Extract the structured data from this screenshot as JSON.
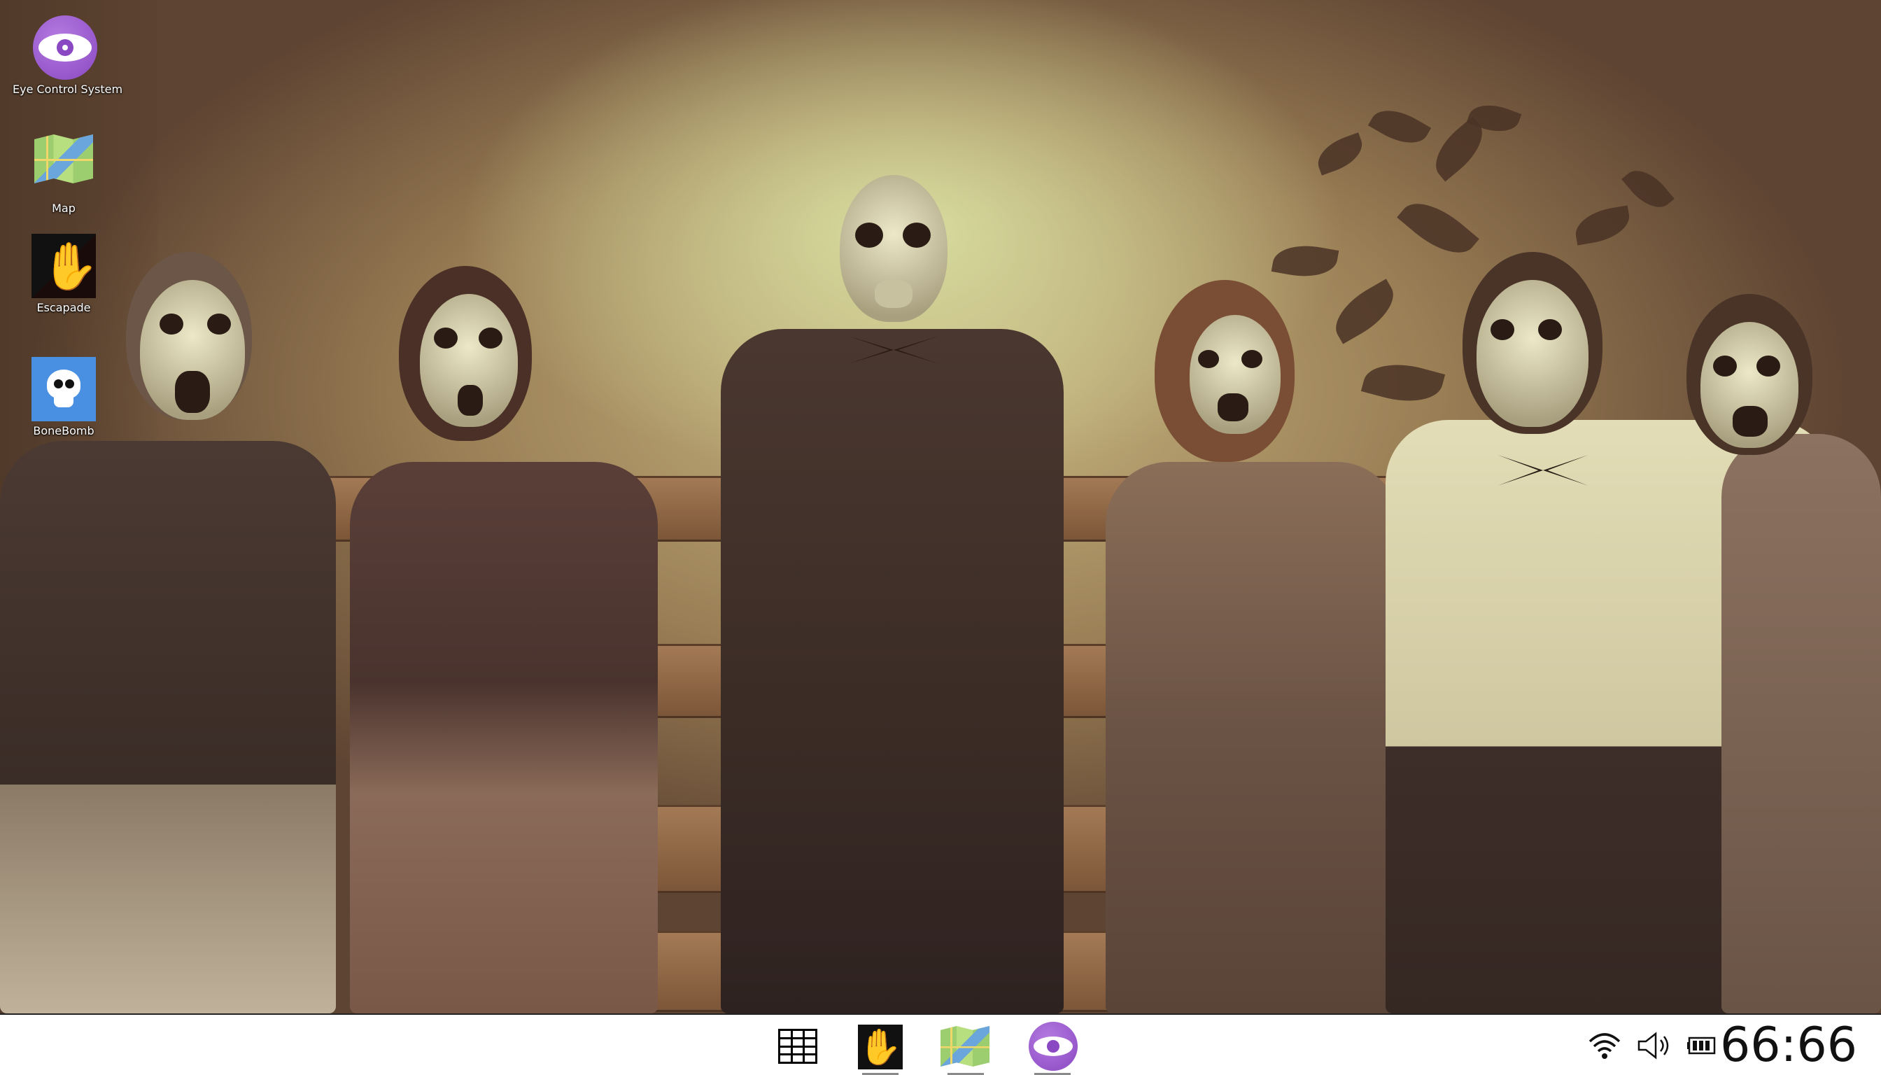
{
  "desktop": {
    "icons": [
      {
        "label": "Eye Control System",
        "icon": "eye-icon"
      },
      {
        "label": "Map",
        "icon": "map-icon"
      },
      {
        "label": "Escapade",
        "icon": "bloody-hand-icon"
      },
      {
        "label": "BoneBomb",
        "icon": "skull-icon"
      }
    ]
  },
  "taskbar": {
    "items": [
      {
        "icon": "app-grid-icon"
      },
      {
        "icon": "bloody-hand-icon"
      },
      {
        "icon": "map-icon"
      },
      {
        "icon": "eye-icon"
      }
    ],
    "tray": {
      "wifi": "wifi-icon",
      "volume": "volume-icon",
      "battery": "battery-icon"
    },
    "clock": "66:66"
  },
  "colors": {
    "taskbar_bg": "#ffffff",
    "eye_purple": "#8a48c2",
    "bone_blue": "#4a90e2",
    "escape_red": "#d21b1b"
  }
}
